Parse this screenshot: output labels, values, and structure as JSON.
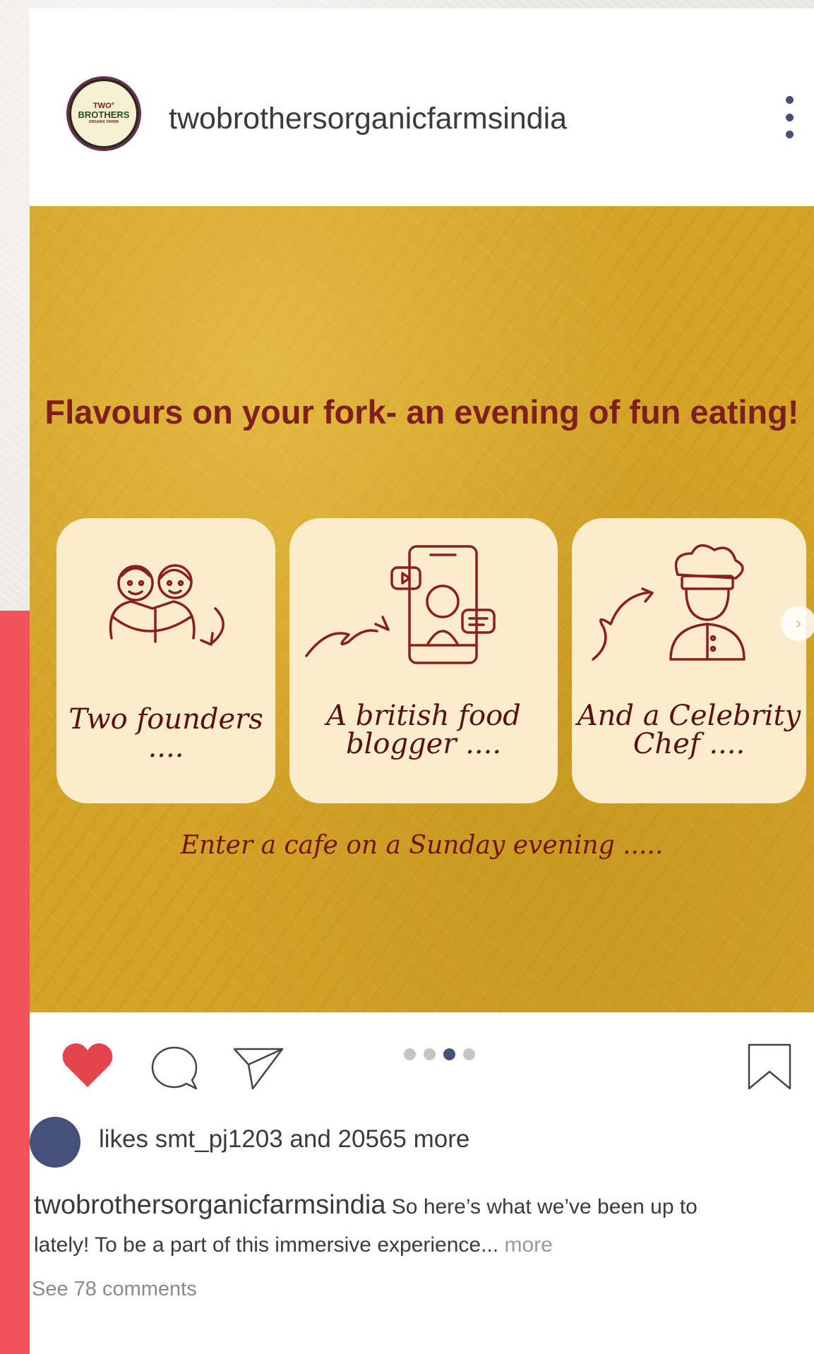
{
  "colors": {
    "accent": "#f0535a",
    "heart": "#e3444d",
    "dot_active": "#46507a",
    "post_bg": "#d4a227",
    "title": "#7e1f1d"
  },
  "header": {
    "avatar_logo": {
      "line1": "TWO°",
      "line2": "BROTHERS",
      "line3": "ORGANIC FARMS"
    },
    "username": "twobrothersorganicfarmsindia",
    "more_icon": "vertical-dots-icon"
  },
  "post": {
    "title": "Flavours on your fork- an evening of fun eating!",
    "panels": [
      {
        "label": "Two founders ....",
        "icon": "two-people-icon"
      },
      {
        "label": "A british food blogger ....",
        "icon": "phone-blogger-icon"
      },
      {
        "label": "And a Celebrity Chef ....",
        "icon": "chef-icon"
      }
    ],
    "footer": "Enter a cafe on a Sunday evening .....",
    "next_icon": "chevron-right-icon",
    "carousel": {
      "count": 4,
      "active_index": 2
    }
  },
  "actions": {
    "like_icon": "heart-icon",
    "comment_icon": "comment-icon",
    "share_icon": "send-icon",
    "save_icon": "bookmark-icon"
  },
  "likes": {
    "text": "likes smt_pj1203 and 20565 more"
  },
  "caption": {
    "user": "twobrothersorganicfarmsindia",
    "text": " So here’s what we’ve been up to lately! To be a part of this immersive experience...",
    "more": "more"
  },
  "comments_link": "See 78 comments"
}
